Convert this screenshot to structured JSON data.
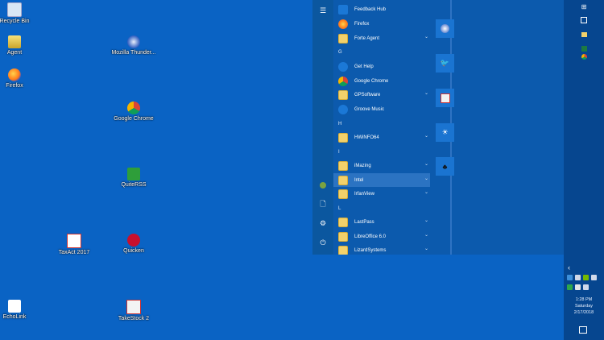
{
  "desktop": {
    "icons": [
      {
        "label": "Recycle Bin",
        "icon": "recycle-bin-icon"
      },
      {
        "label": "Agent",
        "icon": "agent-icon"
      },
      {
        "label": "Firefox",
        "icon": "firefox-icon"
      },
      {
        "label": "Mozilla Thunder...",
        "icon": "thunderbird-icon"
      },
      {
        "label": "Google Chrome",
        "icon": "chrome-icon"
      },
      {
        "label": "QuiteRSS",
        "icon": "rss-icon"
      },
      {
        "label": "TaxAct 2017",
        "icon": "taxact-icon"
      },
      {
        "label": "Quicken",
        "icon": "quicken-icon"
      },
      {
        "label": "EchoLink",
        "icon": "echolink-icon"
      },
      {
        "label": "TakeStock 2",
        "icon": "takestock-icon"
      }
    ]
  },
  "start_menu": {
    "apps": [
      {
        "label": "Feedback Hub",
        "type": "app",
        "icon": "feedback-hub-icon"
      },
      {
        "label": "Firefox",
        "type": "app",
        "icon": "firefox-icon"
      },
      {
        "label": "Forte Agent",
        "type": "folder",
        "icon": "folder-icon"
      },
      {
        "label": "G",
        "type": "letter"
      },
      {
        "label": "Get Help",
        "type": "app",
        "icon": "help-icon"
      },
      {
        "label": "Google Chrome",
        "type": "app",
        "icon": "chrome-icon"
      },
      {
        "label": "GPSoftware",
        "type": "folder",
        "icon": "folder-icon"
      },
      {
        "label": "Groove Music",
        "type": "app",
        "icon": "music-icon"
      },
      {
        "label": "H",
        "type": "letter"
      },
      {
        "label": "HWiNFO64",
        "type": "folder",
        "icon": "folder-icon"
      },
      {
        "label": "I",
        "type": "letter"
      },
      {
        "label": "iMazing",
        "type": "folder",
        "icon": "folder-icon"
      },
      {
        "label": "Intel",
        "type": "folder",
        "icon": "folder-icon",
        "selected": true
      },
      {
        "label": "IrfanView",
        "type": "folder",
        "icon": "folder-icon"
      },
      {
        "label": "L",
        "type": "letter"
      },
      {
        "label": "LastPass",
        "type": "folder",
        "icon": "folder-icon"
      },
      {
        "label": "LibreOffice 6.0",
        "type": "folder",
        "icon": "folder-icon"
      },
      {
        "label": "LizardSystems",
        "type": "folder",
        "icon": "folder-icon"
      }
    ],
    "rail": {
      "menu_icon": "hamburger-icon",
      "user_icon": "user-avatar-icon",
      "documents_icon": "document-icon",
      "settings_icon": "gear-icon",
      "power_icon": "power-icon"
    },
    "tiles": [
      {
        "icon": "thunderbird-tile-icon"
      },
      {
        "icon": "twitter-tile-icon"
      },
      {
        "icon": "gpsoftware-tile-icon"
      },
      {
        "icon": "weather-tile-icon"
      },
      {
        "icon": "echolink-tile-icon"
      }
    ]
  },
  "taskbar": {
    "buttons": [
      {
        "icon": "windows-start-icon"
      },
      {
        "icon": "search-icon"
      },
      {
        "icon": "file-explorer-icon"
      },
      {
        "icon": "excel-icon"
      },
      {
        "icon": "chrome-icon"
      }
    ],
    "tray": {
      "overflow_chevron": "‹",
      "icons": [
        "mail-icon",
        "network-icon",
        "nvidia-icon",
        "volume-icon",
        "check-icon",
        "keyboard-icon",
        "wifi-icon"
      ]
    },
    "clock": {
      "time": "1:28 PM",
      "day": "Saturday",
      "date": "2/17/2018"
    },
    "notification_icon": "action-center-icon"
  },
  "colors": {
    "desktop_bg": "#0a63c4",
    "start_bg": "#0c5aad",
    "taskbar_bg": "#06468f",
    "tile_bg": "#1a74d1",
    "selection": "#2b73c2"
  }
}
